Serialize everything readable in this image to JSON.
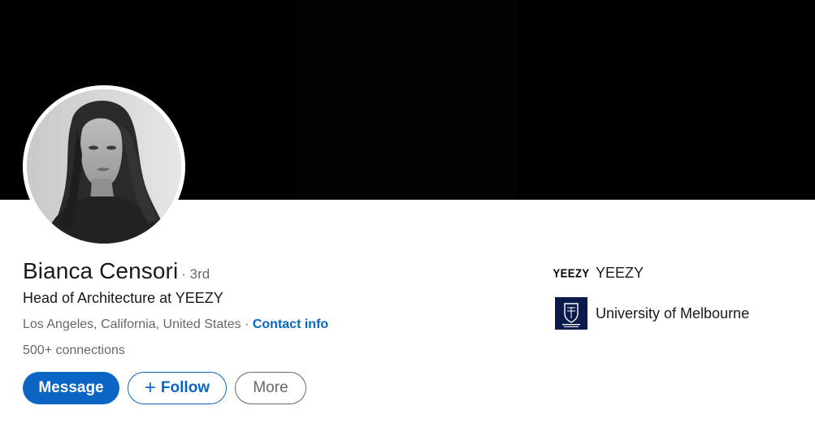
{
  "profile": {
    "name": "Bianca Censori",
    "degree": "· 3rd",
    "headline": "Head of Architecture at YEEZY",
    "location": "Los Angeles, California, United States",
    "separator": "·",
    "contact_label": "Contact info",
    "connections": "500+ connections"
  },
  "actions": {
    "message": "Message",
    "follow_icon": "+",
    "follow": "Follow",
    "more": "More"
  },
  "organizations": [
    {
      "logo_text": "YEEZY",
      "name": "YEEZY"
    },
    {
      "logo_text": "THE UNIVERSITY OF MELBOURNE",
      "name": "University of Melbourne"
    }
  ],
  "colors": {
    "accent": "#0a66c2",
    "banner": "#000000",
    "unimelb_navy": "#0a1a4a"
  },
  "icons": [
    "plus-icon",
    "yeezy-logo",
    "university-crest-icon"
  ]
}
